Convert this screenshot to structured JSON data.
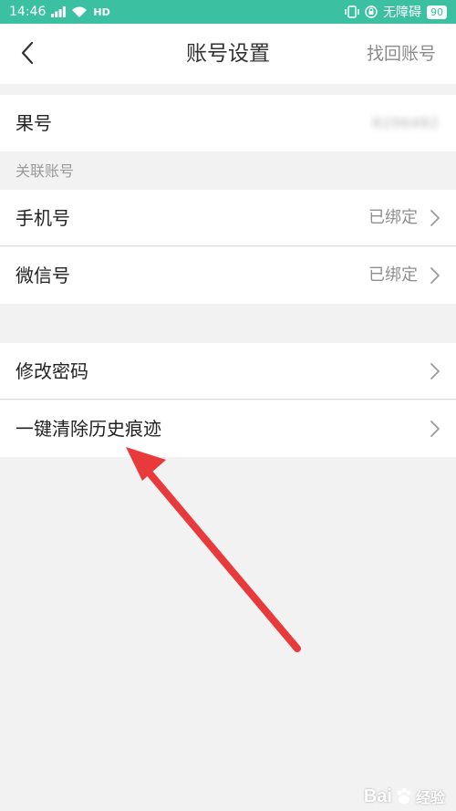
{
  "status_bar": {
    "time": "14:46",
    "network": "HD",
    "accessibility_label": "无障碍",
    "battery": "90"
  },
  "nav": {
    "title": "账号设置",
    "action_label": "找回账号"
  },
  "account": {
    "label": "果号",
    "value": "8296482"
  },
  "linked_section": {
    "header": "关联账号",
    "items": [
      {
        "label": "手机号",
        "value": "已绑定"
      },
      {
        "label": "微信号",
        "value": "已绑定"
      }
    ]
  },
  "security_section": {
    "items": [
      {
        "label": "修改密码"
      },
      {
        "label": "一键清除历史痕迹"
      }
    ]
  },
  "watermark": {
    "text": "Bai",
    "text2": "经验"
  },
  "colors": {
    "status_bar_bg": "#3cc0a2",
    "annotation_arrow": "#e8393b"
  }
}
